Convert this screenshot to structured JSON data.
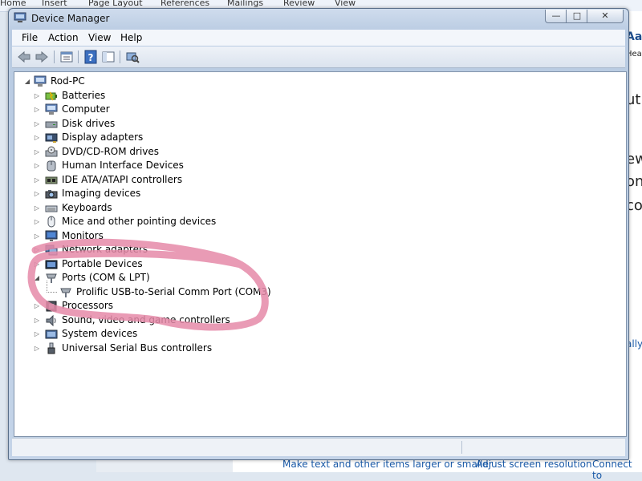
{
  "background_app": {
    "ribbon_tabs": [
      "Home",
      "Insert",
      "Page Layout",
      "References",
      "Mailings",
      "Review",
      "View"
    ],
    "right_fragments": [
      "Aa",
      "Hea",
      "ut",
      "ew",
      "on",
      "co",
      "ally"
    ],
    "bottom_links": [
      "Make text and other items larger or smaller",
      "Adjust screen resolution",
      "Connect to"
    ]
  },
  "window": {
    "title": "Device Manager",
    "controls": {
      "minimize": "—",
      "maximize": "□",
      "close": "✕"
    },
    "menu": [
      "File",
      "Action",
      "View",
      "Help"
    ],
    "toolbar_icons": [
      "back-arrow-icon",
      "forward-arrow-icon",
      "properties-list-icon",
      "help-icon",
      "console-tree-icon",
      "scan-hardware-icon"
    ],
    "tree": {
      "root": "Rod-PC",
      "categories": [
        {
          "label": "Batteries",
          "icon": "battery-icon",
          "expanded": false
        },
        {
          "label": "Computer",
          "icon": "computer-icon",
          "expanded": false
        },
        {
          "label": "Disk drives",
          "icon": "disk-drive-icon",
          "expanded": false
        },
        {
          "label": "Display adapters",
          "icon": "display-adapter-icon",
          "expanded": false
        },
        {
          "label": "DVD/CD-ROM drives",
          "icon": "dvd-drive-icon",
          "expanded": false
        },
        {
          "label": "Human Interface Devices",
          "icon": "hid-icon",
          "expanded": false
        },
        {
          "label": "IDE ATA/ATAPI controllers",
          "icon": "ide-controller-icon",
          "expanded": false
        },
        {
          "label": "Imaging devices",
          "icon": "camera-icon",
          "expanded": false
        },
        {
          "label": "Keyboards",
          "icon": "keyboard-icon",
          "expanded": false
        },
        {
          "label": "Mice and other pointing devices",
          "icon": "mouse-icon",
          "expanded": false
        },
        {
          "label": "Monitors",
          "icon": "monitor-icon",
          "expanded": false
        },
        {
          "label": "Network adapters",
          "icon": "network-adapter-icon",
          "expanded": false
        },
        {
          "label": "Portable Devices",
          "icon": "portable-device-icon",
          "expanded": false
        },
        {
          "label": "Ports (COM & LPT)",
          "icon": "port-icon",
          "expanded": true,
          "children": [
            {
              "label": "Prolific USB-to-Serial Comm Port (COM3)",
              "icon": "port-icon"
            }
          ]
        },
        {
          "label": "Processors",
          "icon": "processor-icon",
          "expanded": false
        },
        {
          "label": "Sound, video and game controllers",
          "icon": "speaker-icon",
          "expanded": false
        },
        {
          "label": "System devices",
          "icon": "system-device-icon",
          "expanded": false
        },
        {
          "label": "Universal Serial Bus controllers",
          "icon": "usb-icon",
          "expanded": false
        }
      ]
    }
  },
  "annotation": {
    "color": "#e58aa8",
    "shape": "hand-drawn ellipse around Ports (COM & LPT)"
  }
}
